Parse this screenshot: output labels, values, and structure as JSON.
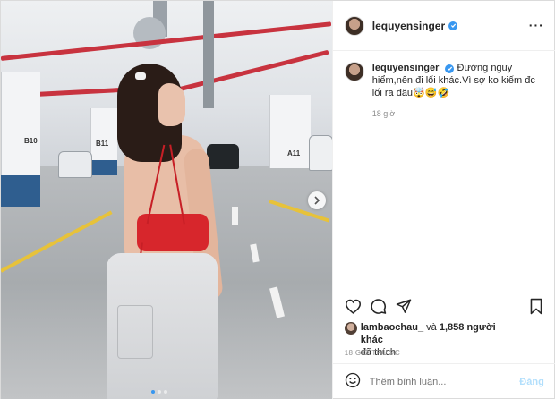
{
  "post": {
    "username": "lequyensinger",
    "verified": true,
    "caption": "Đường nguy hiểm,nên đi lối khác.Vì sợ ko kiếm đc lối ra đâu🤯😅🤣",
    "caption_age": "18 giờ",
    "pillar_labels": [
      "B10",
      "B11",
      "A11"
    ],
    "likes": {
      "liked_by": "lambaochau_",
      "connector": "và",
      "others": "1,858 người khác",
      "suffix": "đã thích"
    },
    "timestamp": "18 GIỜ TRƯỚC",
    "comment_placeholder": "Thêm bình luận...",
    "post_button": "Đăng"
  },
  "icons": {
    "more": "more-horizontal-icon",
    "verified": "verified-badge-icon",
    "like": "heart-icon",
    "comment": "comment-icon",
    "share": "share-icon",
    "save": "bookmark-icon",
    "emoji": "emoji-icon",
    "next": "chevron-right-icon"
  },
  "colors": {
    "accent": "#3897f0",
    "post_button_disabled": "#b2dffc",
    "muted_text": "#8e8e8e"
  }
}
